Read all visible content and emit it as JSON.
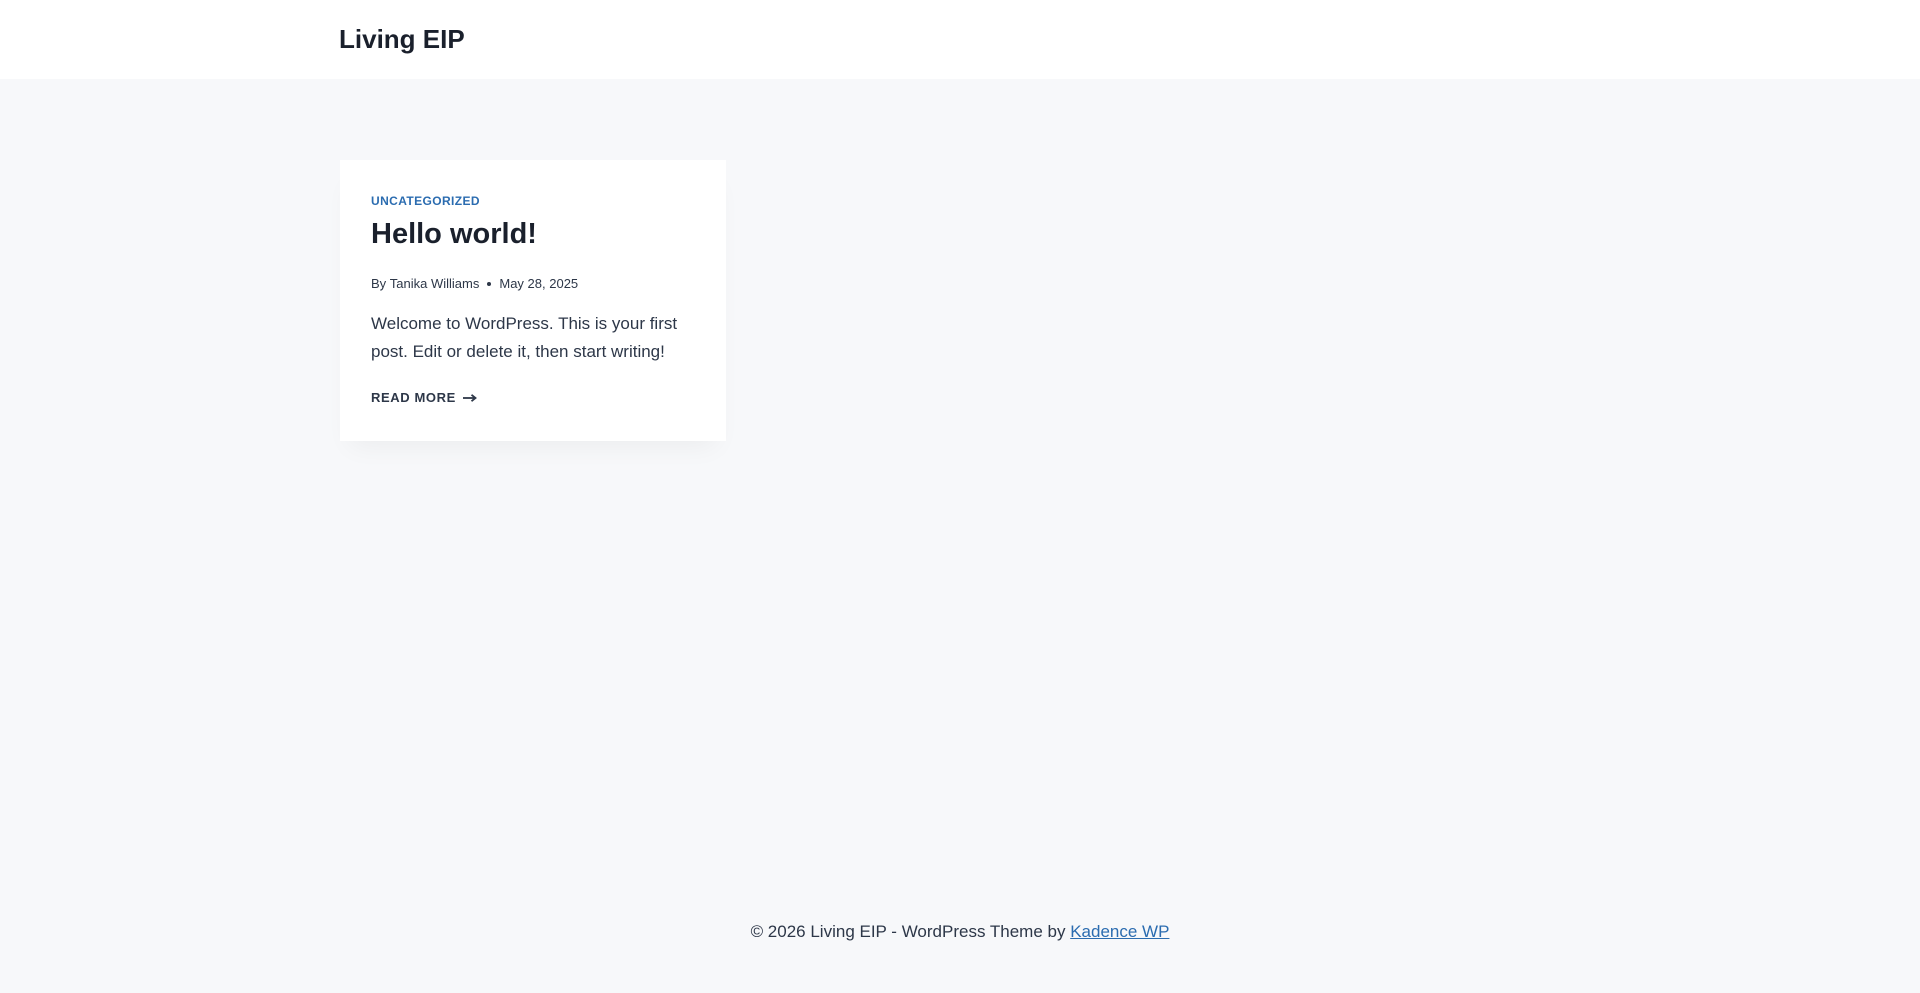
{
  "header": {
    "site_title": "Living EIP"
  },
  "post": {
    "category": "Uncategorized",
    "title": "Hello world!",
    "by_label": "By",
    "author": "Tanika Williams",
    "date": "May 28, 2025",
    "excerpt": "Welcome to WordPress. This is your first post. Edit or delete it, then start writing!",
    "read_more": "Read More",
    "read_more_icon": "long-arrow-right-icon"
  },
  "footer": {
    "text": "© 2026 Living EIP - WordPress Theme by",
    "link_text": "Kadence WP"
  },
  "colors": {
    "accent": "#2b6cb0",
    "heading": "#1a202c",
    "body_text": "#2d3748",
    "page_background": "#f7f8fa",
    "card_background": "#ffffff"
  }
}
